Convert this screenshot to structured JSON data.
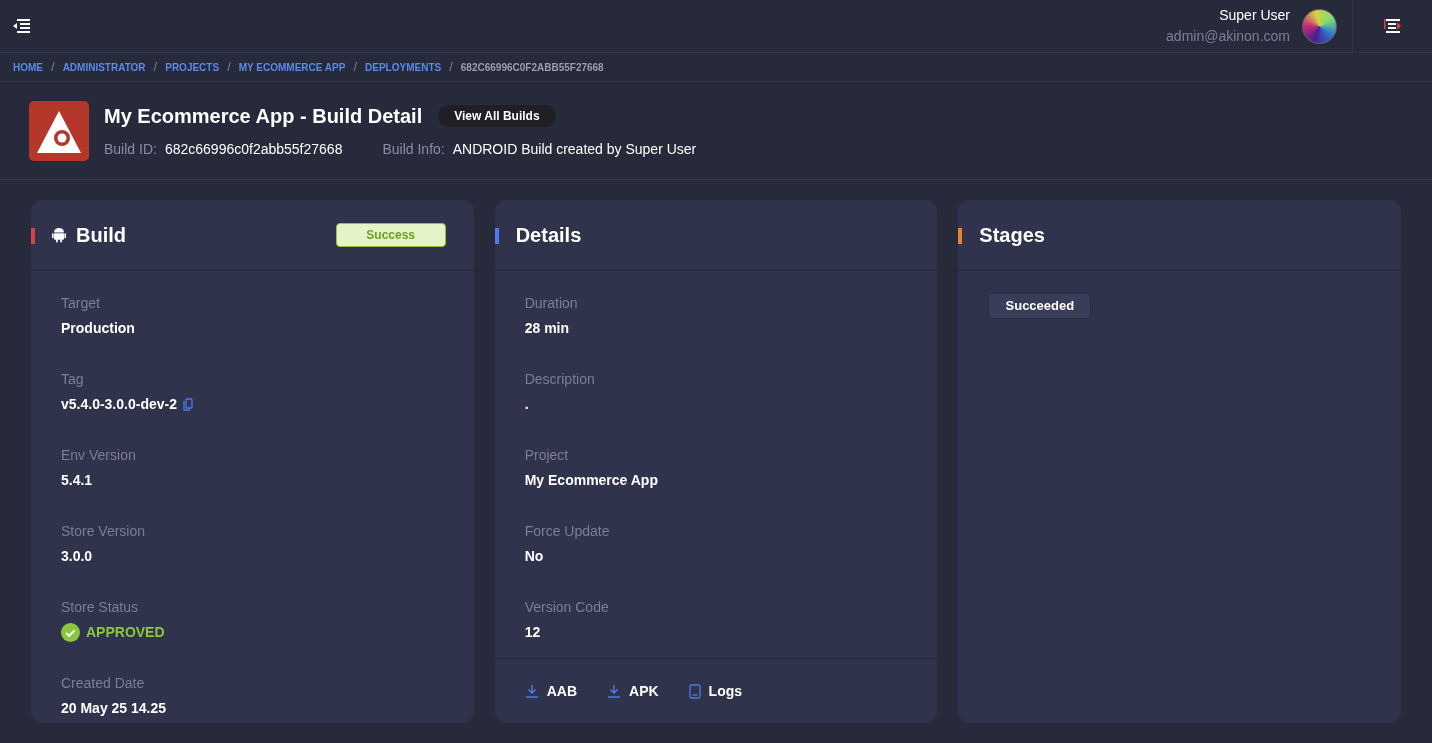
{
  "header": {
    "user_name": "Super User",
    "user_email": "admin@akinon.com"
  },
  "breadcrumb": [
    {
      "label": "HOME",
      "kind": "link"
    },
    {
      "separator": "/",
      "label": "ADMINISTRATOR",
      "kind": "link"
    },
    {
      "separator": "/",
      "label": "PROJECTS",
      "kind": "link"
    },
    {
      "separator": "/",
      "label": "MY ECOMMERCE APP",
      "kind": "link"
    },
    {
      "separator": "/",
      "label": "DEPLOYMENTS",
      "kind": "link"
    },
    {
      "separator": "/",
      "label": "682C66996C0F2ABB55F27668",
      "kind": "current"
    }
  ],
  "page": {
    "title": "My Ecommerce App - Build Detail",
    "button": "View All Builds",
    "meta": [
      {
        "label": "Build ID:",
        "value": "682c66996c0f2abb55f27668"
      },
      {
        "label": "Build Info:",
        "value": "ANDROID Build created by Super User"
      }
    ]
  },
  "cards": [
    {
      "title": "Build",
      "color": "#d9403f",
      "kind": "build",
      "badge": "Success",
      "fields": [
        {
          "label": "Target",
          "value": "Production",
          "kind": "text"
        },
        {
          "label": "Tag",
          "value": "v5.4.0-3.0.0-dev-2",
          "kind": "copy"
        },
        {
          "label": "Env Version",
          "value": "5.4.1",
          "kind": "text"
        },
        {
          "label": "Store Version",
          "value": "3.0.0",
          "kind": "text"
        },
        {
          "label": "Store Status",
          "value": "APPROVED",
          "kind": "status"
        },
        {
          "label": "Created Date",
          "value": "20 May 25 14.25",
          "kind": "text"
        }
      ]
    },
    {
      "title": "Details",
      "color": "#4f78e8",
      "fields": [
        {
          "label": "Duration",
          "value": "28 min",
          "kind": "text"
        },
        {
          "label": "Description",
          "value": ".",
          "kind": "text"
        },
        {
          "label": "Project",
          "value": "My Ecommerce App",
          "kind": "text"
        },
        {
          "label": "Force Update",
          "value": "No",
          "kind": "text"
        },
        {
          "label": "Version Code",
          "value": "12",
          "kind": "text"
        }
      ],
      "actions": [
        {
          "label": "AAB",
          "kind": "download"
        },
        {
          "label": "APK",
          "kind": "download"
        },
        {
          "label": "Logs",
          "kind": "logs"
        }
      ]
    },
    {
      "title": "Stages",
      "color": "#e8833a",
      "stages": [
        "Succeeded"
      ]
    }
  ]
}
